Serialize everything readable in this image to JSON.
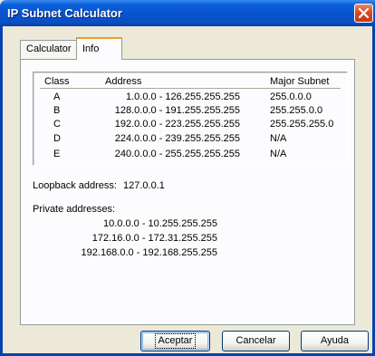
{
  "window": {
    "title": "IP Subnet Calculator"
  },
  "tabs": [
    {
      "label": "Calculator",
      "selected": false
    },
    {
      "label": "Info",
      "selected": true
    }
  ],
  "class_table": {
    "headers": [
      "Class",
      "Address",
      "Major Subnet"
    ],
    "rows": [
      {
        "class": "A",
        "address": "1.0.0.0 - 126.255.255.255",
        "subnet": "255.0.0.0"
      },
      {
        "class": "B",
        "address": "128.0.0.0 - 191.255.255.255",
        "subnet": "255.255.0.0"
      },
      {
        "class": "C",
        "address": "192.0.0.0 - 223.255.255.255",
        "subnet": "255.255.255.0"
      },
      {
        "class": "D",
        "address": "224.0.0.0 - 239.255.255.255",
        "subnet": "N/A"
      },
      {
        "class": "E",
        "address": "240.0.0.0 - 255.255.255.255",
        "subnet": "N/A"
      }
    ]
  },
  "loopback": {
    "label": "Loopback address:",
    "value": "127.0.0.1"
  },
  "private": {
    "label": "Private addresses:",
    "ranges": [
      "10.0.0.0 - 10.255.255.255",
      "172.16.0.0 - 172.31.255.255",
      "192.168.0.0 - 192.168.255.255"
    ]
  },
  "buttons": {
    "ok": "Aceptar",
    "cancel": "Cancelar",
    "help": "Ayuda"
  },
  "colors": {
    "titlebar": "#0853cd",
    "dialog_bg": "#ece9d8",
    "tab_highlight": "#e6a129",
    "close_button": "#d84a22"
  },
  "icons": {
    "close": "close-icon"
  }
}
